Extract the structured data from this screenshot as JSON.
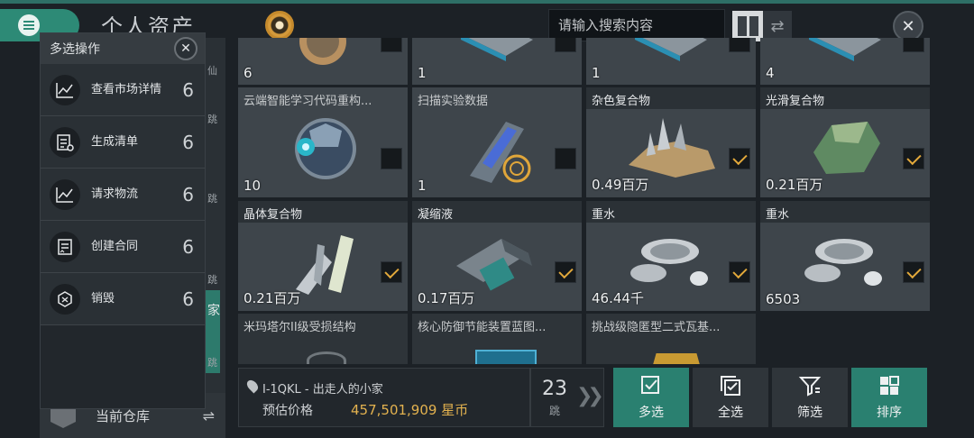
{
  "header": {
    "title": "个人资产",
    "search_placeholder": "请输入搜索内容"
  },
  "left_panel": {
    "strip_labels": [
      "仙",
      "跳",
      "跳",
      "跳",
      "家",
      "跳"
    ],
    "warehouse_label": "当前仓库"
  },
  "popup": {
    "title": "多选操作",
    "actions": [
      {
        "label": "查看市场详情",
        "count": "6",
        "icon": "chart-icon"
      },
      {
        "label": "生成清单",
        "count": "6",
        "icon": "checklist-icon"
      },
      {
        "label": "请求物流",
        "count": "6",
        "icon": "chart-icon"
      },
      {
        "label": "创建合同",
        "count": "6",
        "icon": "contract-icon"
      },
      {
        "label": "销毁",
        "count": "6",
        "icon": "destroy-icon"
      }
    ]
  },
  "grid": {
    "row0_counts": [
      "6",
      "1",
      "1",
      "4"
    ],
    "items": [
      {
        "name": "云端智能学习代码重构...",
        "count": "10",
        "checked": false
      },
      {
        "name": "扫描实验数据",
        "count": "1",
        "checked": false
      },
      {
        "name": "杂色复合物",
        "count": "0.49百万",
        "checked": true
      },
      {
        "name": "光滑复合物",
        "count": "0.21百万",
        "checked": true
      },
      {
        "name": "晶体复合物",
        "count": "0.21百万",
        "checked": true
      },
      {
        "name": "凝缩液",
        "count": "0.17百万",
        "checked": true
      },
      {
        "name": "重水",
        "count": "46.44千",
        "checked": true
      },
      {
        "name": "重水",
        "count": "6503",
        "checked": true
      },
      {
        "name": "米玛塔尔II级受损结构",
        "count": "",
        "checked": false
      },
      {
        "name": "核心防御节能装置蓝图...",
        "count": "",
        "checked": false
      },
      {
        "name": "挑战级隐匿型二式瓦基...",
        "count": "",
        "checked": false
      }
    ]
  },
  "bottom": {
    "location": "I-1QKL - 出走人的小家",
    "price_label": "预估价格",
    "price_value": "457,501,909 星币",
    "jumps": "23",
    "jumps_unit": "跳",
    "buttons": [
      "多选",
      "全选",
      "筛选",
      "排序"
    ]
  },
  "colors": {
    "accent_green": "#2a8070",
    "check_gold": "#e3a93b",
    "price_gold": "#e3b24f"
  }
}
